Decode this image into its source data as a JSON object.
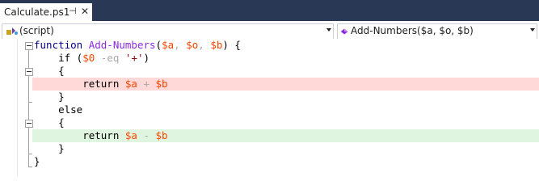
{
  "tab": {
    "title": "Calculate.ps1",
    "pin_glyph": "⊣",
    "close_glyph": "✕"
  },
  "navbar": {
    "scope_label": "(script)",
    "member_label": "Add-Numbers($a, $o, $b)"
  },
  "code": {
    "lines": [
      [
        {
          "t": "function ",
          "c": "kw"
        },
        {
          "t": "Add-Numbers",
          "c": "fn"
        },
        {
          "t": "(",
          "c": "plain"
        },
        {
          "t": "$a",
          "c": "var"
        },
        {
          "t": ", ",
          "c": "op"
        },
        {
          "t": "$o",
          "c": "var"
        },
        {
          "t": ", ",
          "c": "op"
        },
        {
          "t": "$b",
          "c": "var"
        },
        {
          "t": ") {",
          "c": "plain"
        }
      ],
      [
        {
          "t": "    if (",
          "c": "plain"
        },
        {
          "t": "$0",
          "c": "var"
        },
        {
          "t": " -eq ",
          "c": "op"
        },
        {
          "t": "'+'",
          "c": "str"
        },
        {
          "t": ")",
          "c": "plain"
        }
      ],
      [
        {
          "t": "    {",
          "c": "plain"
        }
      ],
      [
        {
          "t": "        return ",
          "c": "plain"
        },
        {
          "t": "$a",
          "c": "var"
        },
        {
          "t": " + ",
          "c": "op"
        },
        {
          "t": "$b",
          "c": "var"
        }
      ],
      [
        {
          "t": "    }",
          "c": "plain"
        }
      ],
      [
        {
          "t": "    else",
          "c": "plain"
        }
      ],
      [
        {
          "t": "    {",
          "c": "plain"
        }
      ],
      [
        {
          "t": "        return ",
          "c": "plain"
        },
        {
          "t": "$a",
          "c": "var"
        },
        {
          "t": " - ",
          "c": "op"
        },
        {
          "t": "$b",
          "c": "var"
        }
      ],
      [
        {
          "t": "    }",
          "c": "plain"
        }
      ],
      [
        {
          "t": "}",
          "c": "plain"
        }
      ]
    ],
    "highlights": {
      "red_line": 4,
      "green_line": 8
    },
    "colors": {
      "red_highlight": "#ffd8d8",
      "green_highlight": "#dff5df",
      "keyword": "#00008b",
      "function": "#8a2be2",
      "variable": "#ff4500",
      "string": "#8b0000",
      "operator": "#a9a9a9"
    }
  }
}
